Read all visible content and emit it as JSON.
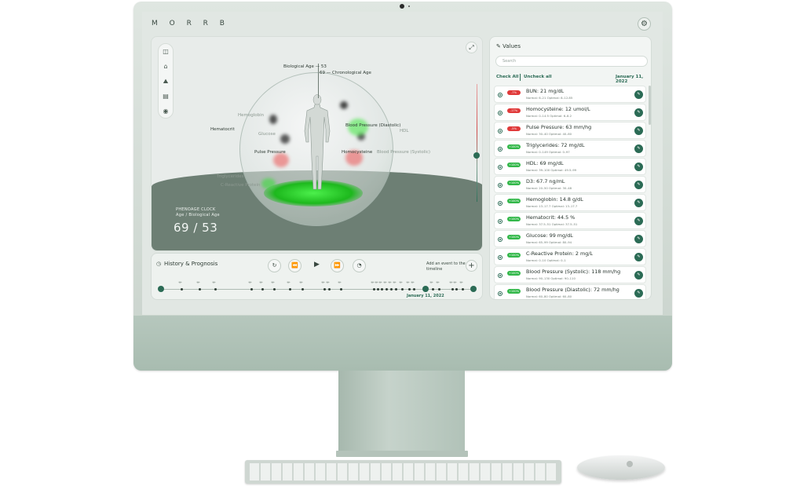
{
  "app": {
    "brand": "M O R R B"
  },
  "icons": {
    "settings": "gear-icon",
    "expand": "expand-icon",
    "edit": "edit-icon",
    "clock": "clock-icon",
    "search": "search-icon"
  },
  "viewer": {
    "tools": [
      "◫",
      "⌂",
      "⛰",
      "▤",
      "◉"
    ],
    "age_label_bio": "Biological Age — 53",
    "age_label_chrono": "69 — Chronological Age",
    "labels": [
      {
        "text": "Hematocrit",
        "style": "normal"
      },
      {
        "text": "Blood Pressure (Diastolic)",
        "style": "normal"
      },
      {
        "text": "Pulse Pressure",
        "style": "normal"
      },
      {
        "text": "Homocysteine",
        "style": "normal"
      },
      {
        "text": "Blood Pressure (Systolic)",
        "style": "faint"
      },
      {
        "text": "Hemoglobin",
        "style": "faint"
      },
      {
        "text": "Glucose",
        "style": "faint"
      },
      {
        "text": "Triglycerides",
        "style": "faint"
      },
      {
        "text": "HDL",
        "style": "faint"
      },
      {
        "text": "C-Reactive Protein",
        "style": "faint"
      }
    ],
    "phenoage_title": "PHENOAGE CLOCK",
    "phenoage_subtitle": "Age / Biological Age",
    "phenoage_value": "69 / 53"
  },
  "history": {
    "title": "History & Prognosis",
    "controls": [
      "↻",
      "⏪",
      "▶",
      "⏩",
      "◔"
    ],
    "add_text": "Add an event to the timeline",
    "add_label": "+",
    "current_date": "January 11, 2022"
  },
  "values": {
    "title": "Values",
    "search_placeholder": "Search",
    "check_all": "Check All",
    "uncheck_all": "Uncheck all",
    "date": "January 11, 2022",
    "items": [
      {
        "badge": "-7%",
        "status": "red",
        "name": "BUN: 21 mg/dL",
        "range": "Normal: 6–21 Optimal: 8–12.85"
      },
      {
        "badge": "-17%",
        "status": "red",
        "name": "Homocysteine: 12 umol/L",
        "range": "Normal: 0–14.5 Optimal: 6–8.2"
      },
      {
        "badge": "-5%",
        "status": "red",
        "name": "Pulse Pressure: 63 mm/hg",
        "range": "Normal: 30–40 Optimal: 40–60"
      },
      {
        "badge": "+100%",
        "status": "green",
        "name": "Triglycerides: 72 mg/dL",
        "range": "Normal: 0–149 Optimal: 0–97"
      },
      {
        "badge": "+100%",
        "status": "green",
        "name": "HDL: 69 mg/dL",
        "range": "Normal: 39–100 Optimal: 49.5–99"
      },
      {
        "badge": "+100%",
        "status": "green",
        "name": "D3: 67.7 ng/mL",
        "range": "Normal: 20–50 Optimal: 30–48"
      },
      {
        "badge": "+100%",
        "status": "green",
        "name": "Hemoglobin: 14.8 g/dL",
        "range": "Normal: 13–17.7 Optimal: 13–17.7"
      },
      {
        "badge": "+100%",
        "status": "green",
        "name": "Hematocrit: 44.5 %",
        "range": "Normal: 37.5–51 Optimal: 37.5–51"
      },
      {
        "badge": "+100%",
        "status": "green",
        "name": "Glucose: 99 mg/dL",
        "range": "Normal: 65–99 Optimal: 80–94"
      },
      {
        "badge": "+100%",
        "status": "green",
        "name": "C-Reactive Protein: 2 mg/L",
        "range": "Normal: 0–10 Optimal: 0–1"
      },
      {
        "badge": "+100%",
        "status": "green",
        "name": "Blood Pressure (Systolic): 118 mm/hg",
        "range": "Normal: 90–130 Optimal: 90–110"
      },
      {
        "badge": "+100%",
        "status": "green",
        "name": "Blood Pressure (Diastolic): 72 mm/hg",
        "range": "Normal: 60–80 Optimal: 60–80"
      }
    ]
  }
}
